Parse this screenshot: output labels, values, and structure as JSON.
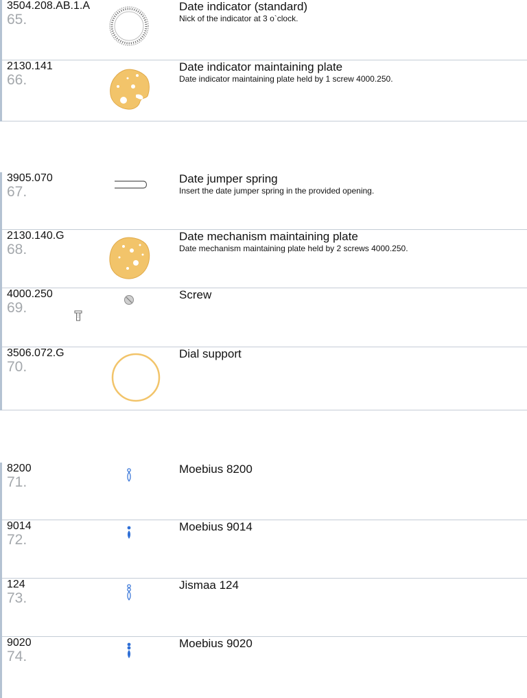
{
  "parts": [
    {
      "ref": "3504.208.AB.1.A",
      "num": "65.",
      "title": "Date indicator (standard)",
      "desc": "Nick of the indicator at 3 o`clock.",
      "icon": "date-ring-icon"
    },
    {
      "ref": "2130.141",
      "num": "66.",
      "title": "Date indicator maintaining plate",
      "desc": "Date indicator maintaining plate held by 1 screw 4000.250.",
      "icon": "gold-plate-icon"
    },
    {
      "ref": "3905.070",
      "num": "67.",
      "title": "Date jumper spring",
      "desc": "Insert the date jumper spring in the provided opening.",
      "icon": "spring-icon"
    },
    {
      "ref": "2130.140.G",
      "num": "68.",
      "title": "Date mechanism maintaining plate",
      "desc": "Date mechanism maintaining plate held by 2 screws 4000.250.",
      "icon": "gold-plate-icon"
    },
    {
      "ref": "4000.250",
      "num": "69.",
      "title": "Screw",
      "desc": "",
      "icon": "screw-icon"
    },
    {
      "ref": "3506.072.G",
      "num": "70.",
      "title": "Dial support",
      "desc": "",
      "icon": "gold-ring-icon"
    },
    {
      "ref": "8200",
      "num": "71.",
      "title": "Moebius 8200",
      "desc": "",
      "icon": "oiler-outline-icon"
    },
    {
      "ref": "9014",
      "num": "72.",
      "title": "Moebius 9014",
      "desc": "",
      "icon": "oiler-filled-icon"
    },
    {
      "ref": "124",
      "num": "73.",
      "title": "Jismaa 124",
      "desc": "",
      "icon": "oiler-outline-icon"
    },
    {
      "ref": "9020",
      "num": "74.",
      "title": "Moebius 9020",
      "desc": "",
      "icon": "oiler-filled-icon"
    }
  ]
}
